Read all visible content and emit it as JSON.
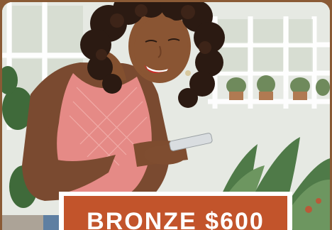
{
  "banner": {
    "price_label": "BRONZE $600"
  },
  "colors": {
    "frame_brown": "#8a5a35",
    "banner_accent": "#c2542b",
    "banner_border": "#ffffff",
    "top_color": "#e58a86"
  }
}
